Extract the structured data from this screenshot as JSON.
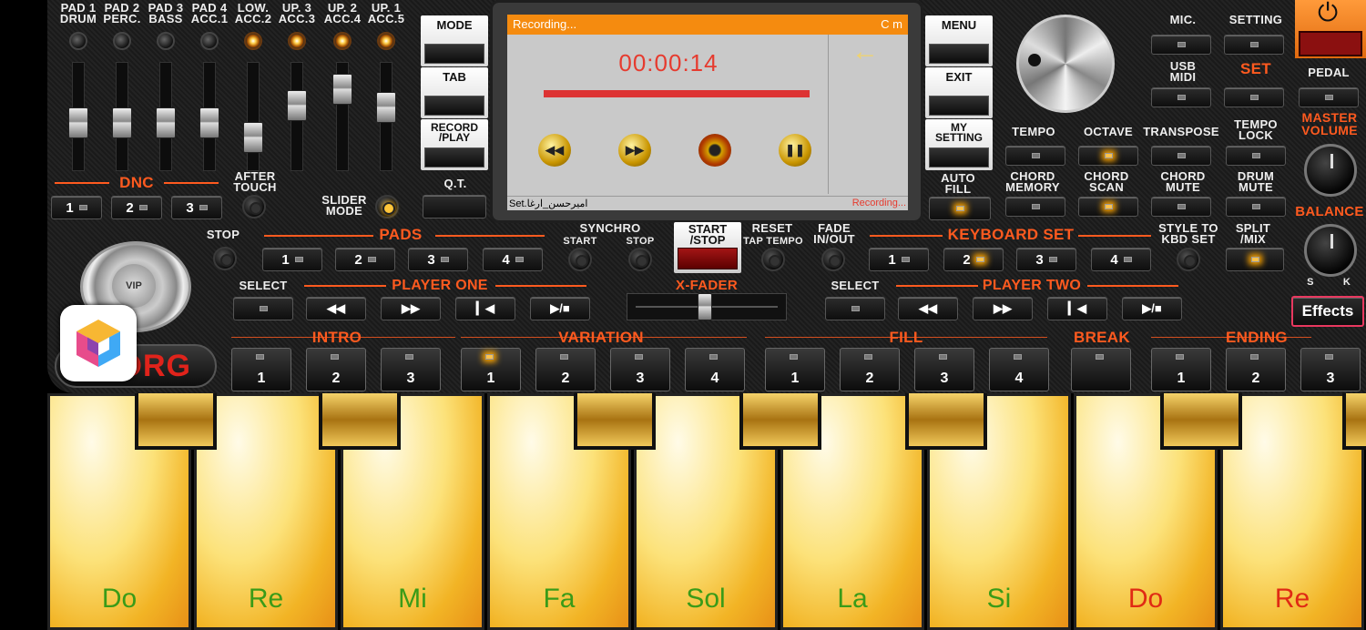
{
  "mixer": {
    "channels": [
      {
        "label": "PAD 1\nDRUM",
        "fader": 0.55
      },
      {
        "label": "PAD 2\nPERC.",
        "fader": 0.55
      },
      {
        "label": "PAD 3\nBASS",
        "fader": 0.55
      },
      {
        "label": "PAD 4\nACC.1",
        "fader": 0.55
      },
      {
        "label": "LOW.\nACC.2",
        "fader": 0.4
      },
      {
        "label": "UP. 3\nACC.3",
        "fader": 0.72
      },
      {
        "label": "UP. 2\nACC.4",
        "fader": 0.88
      },
      {
        "label": "UP. 1\nACC.5",
        "fader": 0.7
      }
    ],
    "dnc": "DNC",
    "after_touch": "AFTER\nTOUCH",
    "slider_mode": "SLIDER\nMODE",
    "dnc_buttons": [
      "1",
      "2",
      "3"
    ]
  },
  "left_buttons": {
    "mode": "MODE",
    "tab": "TAB",
    "record": "RECORD\n/PLAY",
    "qt": "Q.T."
  },
  "screen": {
    "status": "Recording...",
    "corner": "C m",
    "time": "00:00:14",
    "arrow": "←",
    "filename": "Set.امیرحسن_ارغا",
    "status2": "Recording...",
    "progress": 1.0
  },
  "right_buttons": {
    "menu": "MENU",
    "exit": "EXIT",
    "my_setting": "MY\nSETTING",
    "auto_fill": "AUTO\nFILL"
  },
  "upper_right": {
    "mic": "MIC.",
    "setting": "SETTING",
    "usb_midi": "USB\nMIDI",
    "set": "SET",
    "pedal": "PEDAL",
    "master_volume": "MASTER\nVOLUME",
    "tempo": "TEMPO",
    "octave": "OCTAVE",
    "transpose": "TRANSPOSE",
    "tempo_lock": "TEMPO\nLOCK",
    "chord_memory": "CHORD\nMEMORY",
    "chord_scan": "CHORD\nSCAN",
    "chord_mute": "CHORD\nMUTE",
    "drum_mute": "DRUM\nMUTE",
    "balance": "BALANCE",
    "bal_s": "S",
    "bal_k": "K",
    "effects": "Effects"
  },
  "pads": {
    "stop": "STOP",
    "title": "PADS",
    "items": [
      "1",
      "2",
      "3",
      "4"
    ]
  },
  "synchro": {
    "title": "SYNCHRO",
    "start": "START",
    "stop": "STOP"
  },
  "startstop": "START\n/STOP",
  "reset": {
    "title": "RESET",
    "sub": "TAP TEMPO"
  },
  "fade": "FADE\nIN/OUT",
  "keyboard_set": {
    "title": "KEYBOARD SET",
    "items": [
      "1",
      "2",
      "3",
      "4"
    ],
    "style_to_kbd": "STYLE TO\nKBD SET",
    "split_mix": "SPLIT\n/MIX"
  },
  "player_one": {
    "select": "SELECT",
    "title": "PLAYER ONE"
  },
  "player_two": {
    "select": "SELECT",
    "title": "PLAYER TWO"
  },
  "xfader": "X-FADER",
  "style": {
    "intro": "INTRO",
    "variation": "VARIATION",
    "fill": "FILL",
    "break": "BREAK",
    "ending": "ENDING",
    "intro_items": [
      "1",
      "2",
      "3"
    ],
    "variation_items": [
      "1",
      "2",
      "3",
      "4"
    ],
    "fill_items": [
      "1",
      "2",
      "3",
      "4"
    ],
    "ending_items": [
      "1",
      "2",
      "3"
    ]
  },
  "brand": {
    "logo": "KORG",
    "badge": "VIP"
  },
  "keys": [
    "Do",
    "Re",
    "Mi",
    "Fa",
    "Sol",
    "La",
    "Si",
    "Do",
    "Re"
  ]
}
